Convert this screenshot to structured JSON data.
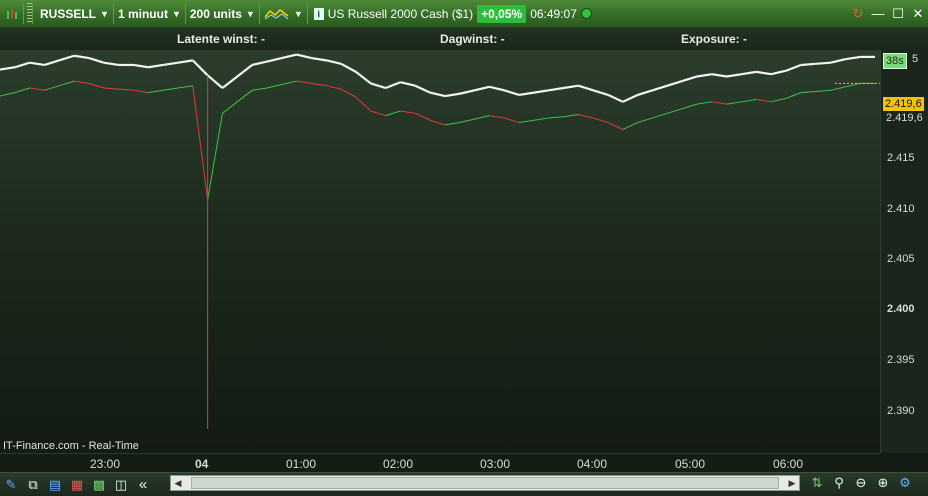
{
  "toolbar": {
    "symbol": "RUSSELL",
    "timeframe": "1 minuut",
    "units": "200 units",
    "instrument": "US Russell 2000 Cash ($1)",
    "change": "+0,05%",
    "time": "06:49:07"
  },
  "infobar": {
    "latent_label": "Latente winst: -",
    "daily_label": "Dagwinst: -",
    "exposure_label": "Exposure: -"
  },
  "axis": {
    "countdown": "38s",
    "price_badge": "2.419,6",
    "price_label": "2.419,6",
    "top_partial": "5",
    "ticks": [
      "2.415",
      "2.410",
      "2.405",
      "2.400",
      "2.395",
      "2.390"
    ]
  },
  "xaxis": [
    "23:00",
    "04",
    "01:00",
    "02:00",
    "03:00",
    "04:00",
    "05:00",
    "06:00"
  ],
  "watermark": "IT-Finance.com - Real-Time",
  "colors": {
    "up": "#3cc24a",
    "down": "#e03a3a",
    "accent": "#2ebd3b"
  },
  "chart_data": {
    "type": "line",
    "title": "",
    "series": [
      {
        "values": [
          2418.5,
          2418.8,
          2419.2,
          2419.0,
          2419.4,
          2419.8,
          2419.6,
          2419.2,
          2419.1,
          2419.0,
          2418.8,
          2419.0,
          2419.2,
          2419.4,
          2409.5,
          2417.0,
          2418.0,
          2419.0,
          2419.2,
          2419.5,
          2419.8,
          2419.6,
          2419.4,
          2419.1,
          2418.4,
          2417.2,
          2416.8,
          2417.2,
          2417.0,
          2416.4,
          2416.0,
          2416.2,
          2416.5,
          2416.8,
          2416.6,
          2416.2,
          2416.4,
          2416.6,
          2416.7,
          2416.9,
          2416.6,
          2416.2,
          2415.6,
          2416.2,
          2416.6,
          2417.0,
          2417.4,
          2417.8,
          2418.0,
          2417.8,
          2418.0,
          2418.2,
          2418.0,
          2418.3,
          2418.8,
          2418.9,
          2419.0,
          2419.3,
          2419.6,
          2419.6
        ]
      },
      {
        "values": [
          2420.8,
          2421.0,
          2421.4,
          2421.2,
          2421.6,
          2422.0,
          2421.8,
          2421.4,
          2421.2,
          2421.2,
          2421.0,
          2421.2,
          2421.4,
          2421.6,
          2420.3,
          2419.2,
          2420.2,
          2421.2,
          2421.5,
          2421.8,
          2422.1,
          2421.8,
          2421.6,
          2421.3,
          2420.6,
          2419.6,
          2419.2,
          2419.7,
          2419.4,
          2418.8,
          2418.5,
          2418.7,
          2419.0,
          2419.3,
          2419.0,
          2418.6,
          2418.8,
          2419.0,
          2419.2,
          2419.4,
          2419.0,
          2418.6,
          2418.0,
          2418.6,
          2419.0,
          2419.4,
          2419.8,
          2420.2,
          2420.4,
          2420.2,
          2420.4,
          2420.6,
          2420.4,
          2420.7,
          2421.2,
          2421.3,
          2421.4,
          2421.7,
          2421.9,
          2421.9
        ]
      }
    ],
    "spike_low": 2389.6,
    "ylim": [
      2387.5,
      2422.5
    ],
    "xlabels": [
      "23:00",
      "04",
      "01:00",
      "02:00",
      "03:00",
      "04:00",
      "05:00",
      "06:00"
    ]
  }
}
